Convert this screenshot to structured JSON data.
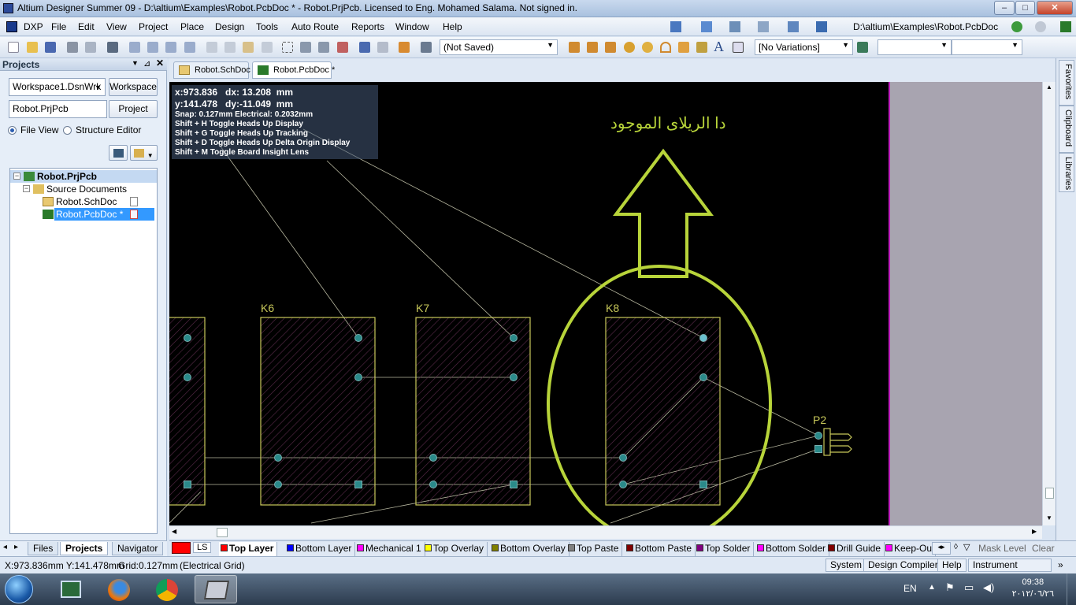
{
  "window": {
    "title": "Altium Designer Summer 09 - D:\\altium\\Examples\\Robot.PcbDoc * - Robot.PrjPcb. Licensed to Eng. Mohamed Salama. Not signed in.",
    "minimize": "–",
    "maximize": "□",
    "close": "✕"
  },
  "menu": {
    "items": [
      "DXP",
      "File",
      "Edit",
      "View",
      "Project",
      "Place",
      "Design",
      "Tools",
      "Auto Route",
      "Reports",
      "Window",
      "Help"
    ],
    "path": "D:\\altium\\Examples\\Robot.PcbDoc"
  },
  "toolbar": {
    "saved_state": "(Not Saved)",
    "variations": "[No Variations]"
  },
  "projects": {
    "title": "Projects",
    "workspace_value": "Workspace1.DsnWrk",
    "workspace_button": "Workspace",
    "project_value": "Robot.PrjPcb",
    "project_button": "Project",
    "view_file": "File View",
    "view_structure": "Structure Editor",
    "tree": {
      "project": "Robot.PrjPcb",
      "folder": "Source Documents",
      "doc1": "Robot.SchDoc",
      "doc2": "Robot.PcbDoc *"
    },
    "tabs": [
      "Files",
      "Projects",
      "Navigator"
    ]
  },
  "doc_tabs": [
    "Robot.SchDoc",
    "Robot.PcbDoc *"
  ],
  "hud": {
    "line1": "x:973.836   dx: 13.208  mm",
    "line2": "y:141.478   dy:-11.049  mm",
    "snap": "Snap: 0.127mm Electrical: 0.2032mm",
    "h1": "Shift + H   Toggle Heads Up Display",
    "h2": "Shift + G   Toggle Heads Up Tracking",
    "h3": "Shift + D   Toggle Heads Up Delta Origin Display",
    "h4": "Shift + M  Toggle Board Insight Lens"
  },
  "annotation": "دا الريلاى الموجود",
  "components": {
    "k6": "K6",
    "k7": "K7",
    "k8": "K8",
    "p2": "P2"
  },
  "right_dock": [
    "Favorites",
    "Clipboard",
    "Libraries"
  ],
  "layers": {
    "ls": "LS",
    "items": [
      {
        "name": "Top Layer",
        "color": "#ff0000"
      },
      {
        "name": "Bottom Layer",
        "color": "#0000ff"
      },
      {
        "name": "Mechanical 1",
        "color": "#ff00ff"
      },
      {
        "name": "Top Overlay",
        "color": "#ffff00"
      },
      {
        "name": "Bottom Overlay",
        "color": "#808000"
      },
      {
        "name": "Top Paste",
        "color": "#808080"
      },
      {
        "name": "Bottom Paste",
        "color": "#800000"
      },
      {
        "name": "Top Solder",
        "color": "#800080"
      },
      {
        "name": "Bottom Solder",
        "color": "#ff00ff"
      },
      {
        "name": "Drill Guide",
        "color": "#800000"
      },
      {
        "name": "Keep-Ou",
        "color": "#ff00ff"
      }
    ],
    "mask_level": "Mask Level",
    "clear": "Clear"
  },
  "status": {
    "coords": "X:973.836mm Y:141.478mm",
    "grid": "Grid:0.127mm",
    "grid_type": "(Electrical Grid)",
    "buttons": [
      "System",
      "Design Compiler",
      "Help",
      "Instrument"
    ]
  },
  "taskbar": {
    "lang": "EN",
    "time": "09:38",
    "date": "٢٠١٢/٠٦/٢٦"
  },
  "colors": {
    "annotation": "#b8d43a",
    "overlay": "#c8c85a",
    "pad": "#2a8a8a",
    "canvas": "#000000"
  }
}
